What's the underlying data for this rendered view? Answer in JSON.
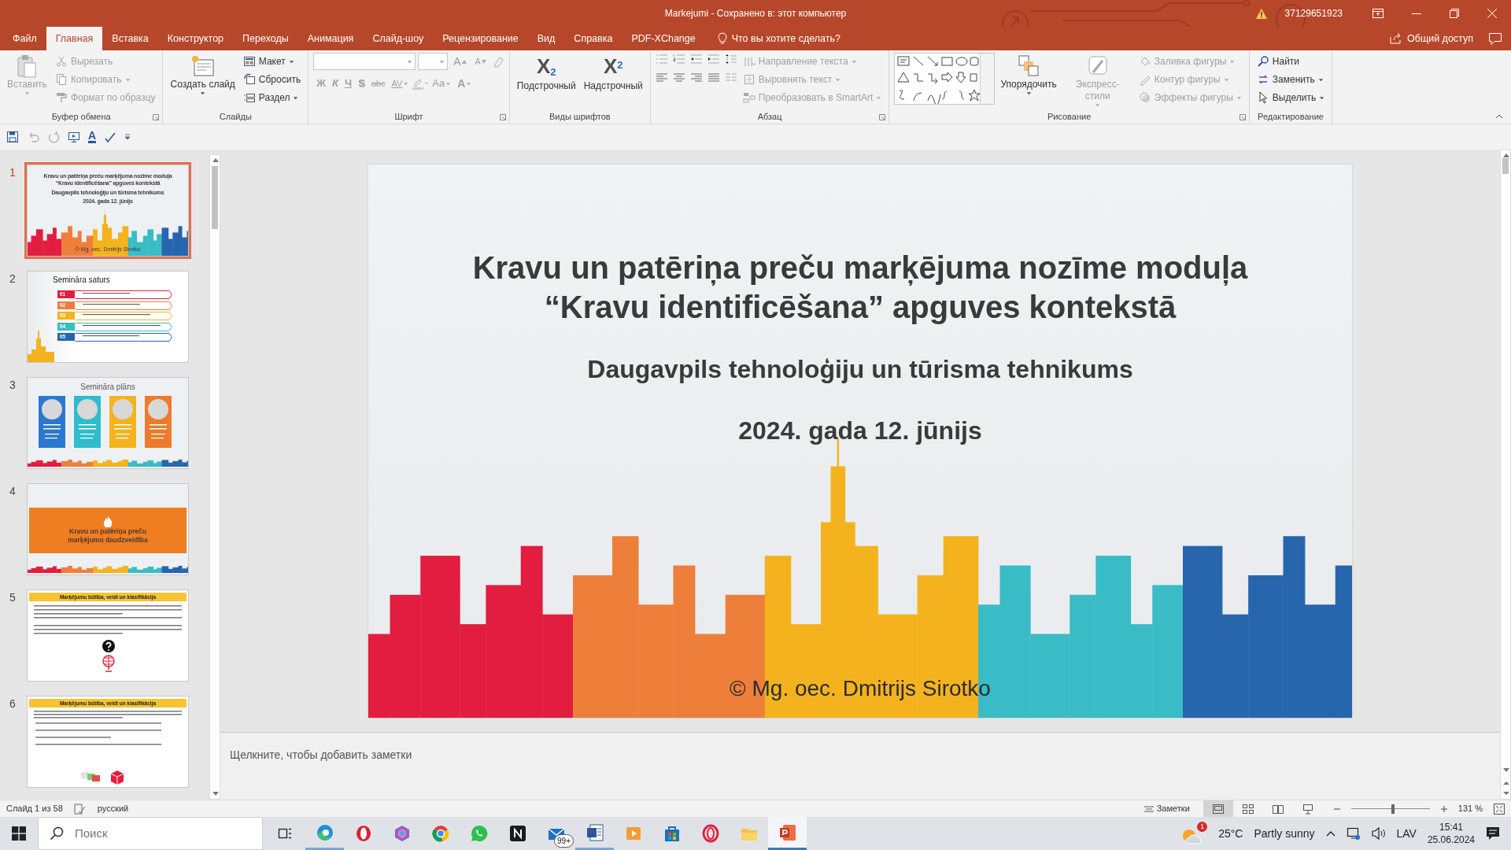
{
  "window": {
    "title": "Markejumi  -  Сохранено в: этот компьютер",
    "account": "37129651923"
  },
  "tabs": [
    {
      "label": "Файл",
      "selected": false
    },
    {
      "label": "Главная",
      "selected": true
    },
    {
      "label": "Вставка",
      "selected": false
    },
    {
      "label": "Конструктор",
      "selected": false
    },
    {
      "label": "Переходы",
      "selected": false
    },
    {
      "label": "Анимация",
      "selected": false
    },
    {
      "label": "Слайд-шоу",
      "selected": false
    },
    {
      "label": "Рецензирование",
      "selected": false
    },
    {
      "label": "Вид",
      "selected": false
    },
    {
      "label": "Справка",
      "selected": false
    },
    {
      "label": "PDF-XChange",
      "selected": false
    }
  ],
  "tell_me": "Что вы хотите сделать?",
  "share": "Общий доступ",
  "ribbon": [
    {
      "kind": "standard",
      "label": "Буфер обмена",
      "launcher": true,
      "items": [
        {
          "kind": "large",
          "label": "Вставить",
          "disabled": true,
          "dropdown": true
        },
        {
          "kind": "small",
          "label": "Вырезать",
          "disabled": true,
          "dropdown": false
        },
        {
          "kind": "small",
          "label": "Копировать",
          "disabled": true,
          "dropdown": true
        },
        {
          "kind": "small",
          "label": "Формат по образцу",
          "disabled": true,
          "dropdown": false
        }
      ]
    },
    {
      "kind": "standard",
      "label": "Слайды",
      "items": [
        {
          "kind": "large",
          "label": "Создать слайд",
          "disabled": false,
          "dropdown": true
        },
        {
          "kind": "small",
          "label": "Макет",
          "disabled": false,
          "dropdown": true
        },
        {
          "kind": "small",
          "label": "Сбросить",
          "disabled": false,
          "dropdown": false
        },
        {
          "kind": "small",
          "label": "Раздел",
          "disabled": false,
          "dropdown": true
        }
      ]
    },
    {
      "kind": "font",
      "label": "Шрифт",
      "launcher": true,
      "items": [
        {
          "kind": "stepper",
          "label": "A",
          "disabled": true,
          "dropdown": false
        },
        {
          "kind": "stepper",
          "label": "A",
          "disabled": true,
          "dropdown": false
        },
        {
          "kind": "glyph",
          "label": "Ж",
          "disabled": true,
          "dropdown": false
        },
        {
          "kind": "glyph",
          "label": "К",
          "disabled": true,
          "dropdown": false
        },
        {
          "kind": "glyph",
          "label": "Ч",
          "disabled": true,
          "dropdown": false
        },
        {
          "kind": "glyph",
          "label": "S",
          "disabled": true,
          "dropdown": false
        },
        {
          "kind": "glyph",
          "label": "abc",
          "disabled": true,
          "dropdown": false
        },
        {
          "kind": "glyph",
          "label": "AV",
          "disabled": true,
          "dropdown": true
        },
        {
          "kind": "glyph",
          "label": "Aa",
          "disabled": true,
          "dropdown": true
        },
        {
          "kind": "glyph",
          "label": "A",
          "disabled": true,
          "dropdown": true
        }
      ]
    },
    {
      "kind": "standard",
      "label": "Виды шрифтов",
      "items": [
        {
          "kind": "large",
          "label": "Подстрочный",
          "glyph": "X$_{2}$",
          "disabled": false,
          "dropdown": false
        },
        {
          "kind": "large",
          "label": "Надстрочный",
          "glyph": "X$^{2}$",
          "disabled": false,
          "dropdown": false
        }
      ]
    },
    {
      "kind": "paragraph",
      "label": "Абзац",
      "launcher": true,
      "items": [
        {
          "kind": "small",
          "label": "Направление текста",
          "disabled": true,
          "dropdown": true
        },
        {
          "kind": "small",
          "label": "Выровнять текст",
          "disabled": true,
          "dropdown": true
        },
        {
          "kind": "small",
          "label": "Преобразовать в SmartArt",
          "disabled": true,
          "dropdown": true
        }
      ]
    },
    {
      "kind": "drawing",
      "label": "Рисование",
      "launcher": true,
      "items": [
        {
          "kind": "large",
          "label": "Упорядочить",
          "disabled": false,
          "dropdown": true
        },
        {
          "kind": "large",
          "label": "Экспресс-стили",
          "disabled": true,
          "dropdown": true
        },
        {
          "kind": "small",
          "label": "Заливка фигуры",
          "disabled": true,
          "dropdown": true
        },
        {
          "kind": "small",
          "label": "Контур фигуры",
          "disabled": true,
          "dropdown": true
        },
        {
          "kind": "small",
          "label": "Эффекты фигуры",
          "disabled": true,
          "dropdown": true
        }
      ]
    },
    {
      "kind": "standard",
      "label": "Редактирование",
      "items": [
        {
          "kind": "small",
          "label": "Найти",
          "disabled": false,
          "dropdown": false
        },
        {
          "kind": "small",
          "label": "Заменить",
          "disabled": false,
          "dropdown": true
        },
        {
          "kind": "small",
          "label": "Выделить",
          "disabled": false,
          "dropdown": true
        }
      ]
    }
  ],
  "quick_access": [
    {
      "disabled": false
    },
    {
      "disabled": true
    },
    {
      "disabled": true
    },
    {
      "disabled": false
    },
    {
      "disabled": false,
      "glyph": "A"
    },
    {
      "disabled": false
    }
  ],
  "slides": [
    {
      "number": "1",
      "selected": true,
      "kind": "title",
      "lines": [
        "Kravu un patēriņa preču marķējuma nozīme moduļa",
        "“Kravu identificēšana” apguves kontekstā",
        "Daugavpils tehnoloģiju un tūrisma tehnikums",
        "2024. gada 12. jūnijs"
      ],
      "footer": "© Mg. oec. Dmitrijs Sirotko"
    },
    {
      "number": "2",
      "selected": false,
      "kind": "agenda",
      "title": "Semināra saturs",
      "items": [
        "01",
        "02",
        "03",
        "04",
        "05"
      ]
    },
    {
      "number": "3",
      "selected": false,
      "kind": "plan",
      "title": "Semināra plāns"
    },
    {
      "number": "4",
      "selected": false,
      "kind": "section",
      "title": "Kravu un patēriņa preču marķējumu daudzveidība"
    },
    {
      "number": "5",
      "selected": false,
      "kind": "question",
      "title": "Marķējumu būtība, veidi un klasifikācija"
    },
    {
      "number": "6",
      "selected": false,
      "kind": "checklist",
      "title": "Marķējumu būtība, veidi un klasifikācija"
    }
  ],
  "slide": {
    "title_lines": [
      "Kravu un patēriņa preču marķējuma nozīme moduļa",
      "“Kravu identificēšana” apguves kontekstā"
    ],
    "subtitle": "Daugavpils tehnoloģiju un tūrisma tehnikums",
    "date": "2024. gada 12. jūnijs",
    "author": "© Mg. oec. Dmitrijs Sirotko"
  },
  "notes_prompt": "Щелкните, чтобы добавить заметки",
  "status_bar": {
    "slide_info": "Слайд 1 из 58",
    "language": "русский",
    "notes": "Заметки",
    "views": [
      {
        "selected": true
      },
      {
        "selected": false
      },
      {
        "selected": false
      },
      {
        "selected": false
      }
    ],
    "zoom": {
      "level": 0.53
    },
    "zoom_text": "131 %"
  },
  "taskbar": {
    "search": {
      "placeholder": "Поиск"
    },
    "apps": [
      {
        "selected": false,
        "running": true
      },
      {
        "selected": false,
        "running": false
      },
      {
        "selected": false,
        "running": false
      },
      {
        "selected": false,
        "running": false
      },
      {
        "selected": false,
        "running": false
      },
      {
        "selected": false,
        "running": false
      },
      {
        "selected": false,
        "running": false,
        "badge": "99+"
      },
      {
        "selected": false,
        "running": true
      },
      {
        "selected": false,
        "running": false
      },
      {
        "selected": false,
        "running": false
      },
      {
        "selected": false,
        "running": false
      },
      {
        "selected": false,
        "running": false
      },
      {
        "selected": true,
        "running": true
      }
    ],
    "weather": {
      "badge": "1",
      "temperature": "25°C",
      "condition": "Partly sunny"
    },
    "language": "LAV",
    "time": "15:41",
    "date": "25.06.2024"
  }
}
